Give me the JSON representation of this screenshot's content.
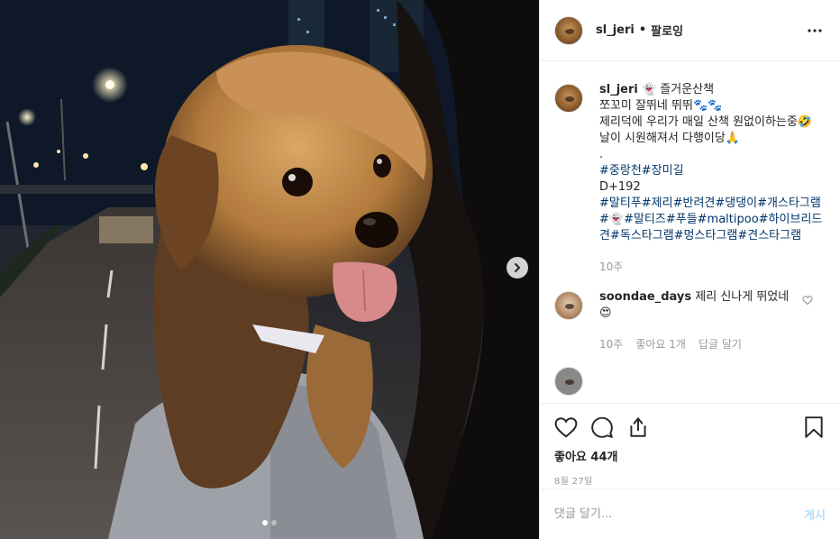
{
  "post": {
    "username": "sl_jeri",
    "separator": "•",
    "follow_label": "팔로잉"
  },
  "caption": {
    "username": "sl_jeri",
    "line1": "👻 즐거운산책",
    "line2": "쪼꼬미 잘뛰네 뛰뛰🐾🐾",
    "line3": "제리덕에 우리가 매일 산책 원없이하는중🤣",
    "line4": "날이 시원해져서 다행이당🙏",
    "line5": ".",
    "tags1": "#중랑천#장미길",
    "line6": "D+192",
    "tags2": "#말티푸#제리#반려견#댕댕이#개스타그램#👻#말티즈#푸들#maltipoo#하이브리드견#독스타그램#멍스타그램#견스타그램",
    "time": "10주"
  },
  "comment1": {
    "username": "soondae_days",
    "text": "제리 신나게 뛰었네 😍",
    "time": "10주",
    "likes": "좋아요 1개",
    "reply": "답글 달기"
  },
  "engagement": {
    "likes": "좋아요 44개",
    "date": "8월 27일"
  },
  "add_comment": {
    "placeholder": "댓글 달기...",
    "post_label": "게시"
  },
  "carousel": {
    "total": 2,
    "current": 1
  },
  "colors": {
    "link": "#003569",
    "muted": "#999999",
    "post_disabled": "#b2dffc"
  },
  "icons": [
    "more-icon",
    "next-arrow-icon",
    "heart-icon",
    "comment-icon",
    "share-icon",
    "bookmark-icon",
    "heart-small-icon"
  ]
}
